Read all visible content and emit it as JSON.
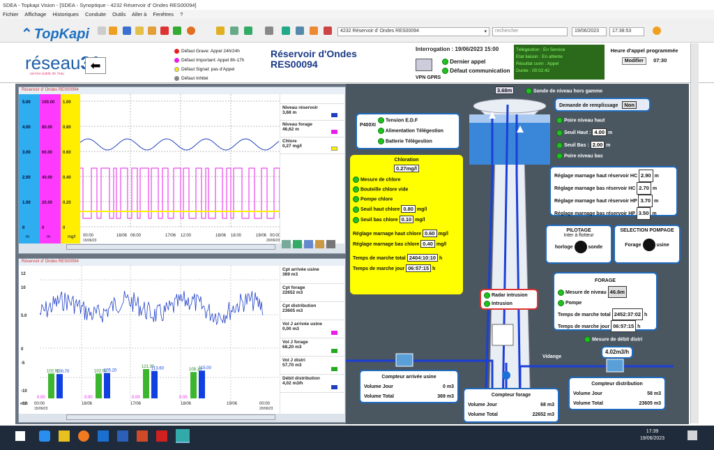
{
  "titlebar": {
    "text": "SDEA - Topkapi Vision - [SDEA - Synoptique - 4232 Réservoir d' Ondes RES00094]"
  },
  "menu": [
    "Fichier",
    "Affichage",
    "Historiques",
    "Conduite",
    "Outils",
    "Aller à",
    "Fenêtres",
    "?"
  ],
  "toolbar": {
    "logo": "TopKapi",
    "site_select": "4232 Réservoir d' Ondes RES00094",
    "search_placeholder": "rechercher",
    "date": "19/06/2023",
    "time": "17:38:53"
  },
  "header": {
    "brand_main": "réseau",
    "brand_num": "31",
    "brand_sub": "service public de l'eau",
    "legend": [
      {
        "label": "Défaut Grave: Appel 24h/24h",
        "color": "#e61e1e"
      },
      {
        "label": "Défaut Important: Appel 8h-17h",
        "color": "#e81ee8"
      },
      {
        "label": "Défaut Signal: pas d'Appel",
        "color": "#ffee00"
      },
      {
        "label": "Défaut Inhibé",
        "color": "#888888"
      }
    ],
    "site_title_1": "Réservoir d'Ondes",
    "site_title_2": "RES00094",
    "interrogation": "Interrogation :  19/06/2023 15:00",
    "dernier_appel": "Dernier appel",
    "defaut_comm": "Défaut communication",
    "vpn": "VPN GPRS",
    "teleg": [
      "Télégestion :  En Service",
      "Etat liaison :  En attente",
      "Résultat conn : Appel",
      "Durée :              00:02:42"
    ],
    "appel_title": "Heure d'appel programmée",
    "modifier": "Modifier",
    "appel_time": "07:30"
  },
  "trend1": {
    "title": "Réservoir d' Ondes RES00094",
    "y1": [
      "5.00",
      "4.00",
      "3.00",
      "2.00",
      "1.00",
      "0"
    ],
    "y2": [
      "100.00",
      "80.00",
      "60.00",
      "40.00",
      "20.00",
      "0"
    ],
    "y3": [
      "1.00",
      "0.80",
      "0.60",
      "0.40",
      "0.20",
      "0"
    ],
    "units": [
      "m",
      "m",
      "mg/l"
    ],
    "x": [
      "00:00",
      "06:00",
      "12:00",
      "18:00",
      "00:00"
    ],
    "xdates": [
      "15/06/23",
      "16/06",
      "17/06",
      "18/06",
      "19/06",
      "20/06/23"
    ],
    "side": [
      {
        "name": "Niveau réservoir",
        "val": "3,68",
        "unit": "m",
        "color": "#1f3fbf"
      },
      {
        "name": "Niveau forage",
        "val": "46,62",
        "unit": "m",
        "color": "#e81ee8"
      },
      {
        "name": "Chlore",
        "val": "0,27",
        "unit": "mg/l",
        "color": "#ffee00"
      }
    ]
  },
  "trend2": {
    "title": "Réservoir d' Ondes RES00094",
    "y": [
      "12",
      "10",
      "5.0",
      "0",
      "-5",
      "-10",
      "-12"
    ],
    "xunit": "m3/h",
    "bar_labels": [
      "102.90",
      "100.70",
      "102.90",
      "105.20",
      "121.30",
      "113.60",
      "109.10",
      "115.00"
    ],
    "zero_labels": [
      "0.00",
      "0.00",
      "0.00",
      "0.00"
    ],
    "x": [
      "00:00",
      "00:00"
    ],
    "xdates": [
      "15/06/23",
      "16/06",
      "17/06",
      "18/06",
      "19/06",
      "20/06/23"
    ],
    "side": [
      {
        "name": "Cpt arrivée usine",
        "val": "369",
        "unit": "m3",
        "color": "#ffffff"
      },
      {
        "name": "Cpt forage",
        "val": "22652",
        "unit": "m3",
        "color": "#ffffff"
      },
      {
        "name": "Cpt distribution",
        "val": "23605",
        "unit": "m3",
        "color": "#ffffff"
      },
      {
        "name": "Vol J arrivée usine",
        "val": "0,00",
        "unit": "m3",
        "color": "#e81ee8"
      },
      {
        "name": "Vol J forage",
        "val": "68,20",
        "unit": "m3",
        "color": "#22aa22"
      },
      {
        "name": "Vol J distri",
        "val": "57,70",
        "unit": "m3",
        "color": "#22aa22"
      },
      {
        "name": "Débit distribution",
        "val": "4,02",
        "unit": "m3/h",
        "color": "#1f3fbf"
      }
    ]
  },
  "syno": {
    "level": "3.68m",
    "sonde_hors": "Sonde de niveau hors gamme",
    "p400": "P400XI",
    "tension": "Tension E.D.F",
    "alim": "Alimentation Télégestion",
    "batterie": "Batterie Télégestion",
    "chloration": "Chloration",
    "chlore_val": "0.27mg/l",
    "mesure_chlore": "Mesure de chlore",
    "bouteille": "Bouteille chlore vide",
    "pompe_chlore": "Pompe chlore",
    "seuil_haut_chlore": "Seuil haut chlore",
    "seuil_haut_chlore_v": "0.80",
    "seuil_bas_chlore": "Seuil bas chlore",
    "seuil_bas_chlore_v": "0.10",
    "mgl": "mg/l",
    "reg_haut_chlore": "Réglage marnage haut chlore",
    "reg_haut_chlore_v": "0.60",
    "reg_bas_chlore": "Réglage marnage bas chlore",
    "reg_bas_chlore_v": "0.40",
    "tm_total": "Temps de marche total",
    "tm_total_v": "2404:10:10",
    "tm_jour": "Temps de marche jour",
    "tm_jour_v": "06:57:15",
    "h": "h",
    "demande": "Demande de remplissage",
    "demande_v": "Non",
    "poire_haut": "Poire niveau haut",
    "seuil_haut": "Seuil Haut :",
    "seuil_haut_v": "4.00",
    "seuil_bas": "Seuil Bas :",
    "seuil_bas_v": "2.00",
    "m": "m",
    "poire_bas": "Poire niveau bas",
    "reg": [
      {
        "label": "Réglage marnage haut réservoir HC",
        "v": "2.90"
      },
      {
        "label": "Réglage marnage bas réservoir HC",
        "v": "2.70"
      },
      {
        "label": "Réglage marnage haut réservoir HP",
        "v": "3.70"
      },
      {
        "label": "Réglage marnage bas réservoir HP",
        "v": "3.50"
      }
    ],
    "pilotage": "PILOTAGE",
    "pilotage_sub": "Inter à flotteur",
    "horloge": "horloge",
    "sonde": "sonde",
    "selection": "SELECTION POMPAGE",
    "forage_l": "Forage",
    "usine": "usine",
    "forage_title": "FORAGE",
    "mesure_niveau": "Mesure de niveau",
    "mesure_niveau_v": "46.6m",
    "pompe": "Pompe",
    "f_tm_total_v": "2452:37:02",
    "f_tm_jour_v": "06:57:15",
    "radar": "Radar intrusion",
    "intrusion": "Intrusion",
    "mesure_debit": "Mesure de débit distri",
    "debit_v": "4.02m3/h",
    "vidange": "Vidange",
    "cpt_usine": "Compteur arrivée usine",
    "vol_jour": "Volume Jour",
    "vol_total": "Volume Total",
    "usine_j": "0 m3",
    "usine_t": "369 m3",
    "cpt_forage": "Compteur forage",
    "forage_j": "68 m3",
    "forage_t": "22652 m3",
    "cpt_distri": "Compteur distribution",
    "distri_j": "58 m3",
    "distri_t": "23605 m3"
  },
  "taskbar": {
    "time": "17:39",
    "date": "19/06/2023"
  }
}
